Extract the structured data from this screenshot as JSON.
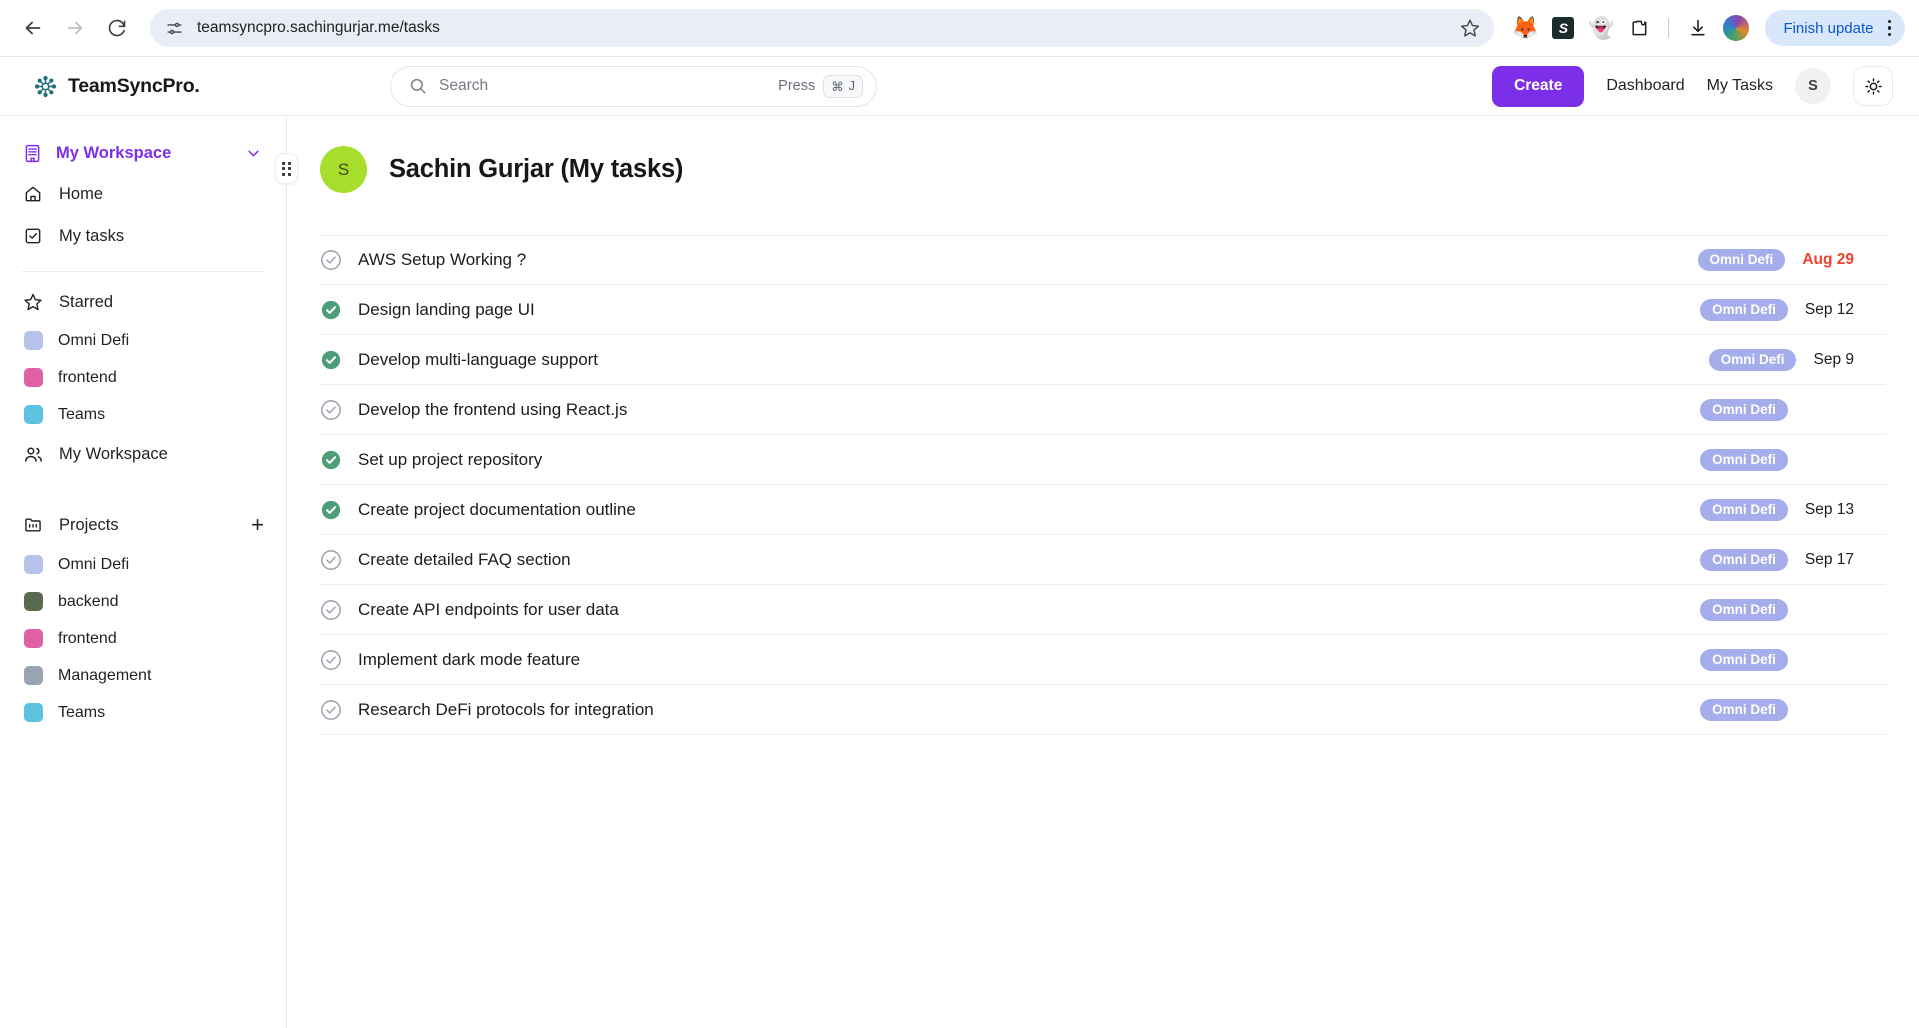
{
  "browser": {
    "back_label": "Back",
    "forward_label": "Forward",
    "reload_label": "Reload",
    "site_info_icon": "tune-icon",
    "url": "teamsyncpro.sachingurjar.me/tasks",
    "bookmark_icon": "star-icon",
    "extensions": [
      {
        "name": "metamask-extension-icon",
        "glyph": "🦊"
      },
      {
        "name": "sublime-extension-icon",
        "glyph": "S"
      },
      {
        "name": "ghost-extension-icon",
        "glyph": "👻"
      },
      {
        "name": "extensions-puzzle-icon",
        "glyph": "⧉"
      }
    ],
    "download_icon": "download-icon",
    "profile_icon": "profile-avatar",
    "update_button": "Finish update",
    "menu_icon": "three-dot-menu-icon"
  },
  "header": {
    "logo_icon": "teamsync-gear-icon",
    "brand": "TeamSyncPro.",
    "search": {
      "icon": "search-icon",
      "placeholder": "Search",
      "value": "",
      "hint_text": "Press",
      "hint_key_cmd": "⌘",
      "hint_key_letter": "J"
    },
    "create_label": "Create",
    "nav": [
      {
        "label": "Dashboard",
        "name": "nav-dashboard"
      },
      {
        "label": "My Tasks",
        "name": "nav-my-tasks"
      }
    ],
    "avatar_initial": "S",
    "theme_toggle_icon": "sun-icon"
  },
  "sidebar": {
    "workspace": {
      "icon": "building-icon",
      "label": "My Workspace",
      "chevron_icon": "chevron-down-icon",
      "accent": "#7c2fe8"
    },
    "nav_items": [
      {
        "label": "Home",
        "icon": "home-icon",
        "name": "sidebar-item-home"
      },
      {
        "label": "My tasks",
        "icon": "check-square-icon",
        "name": "sidebar-item-my-tasks"
      }
    ],
    "starred": {
      "label": "Starred",
      "icon": "star-outline-icon",
      "items": [
        {
          "label": "Omni Defi",
          "color": "#b8c3ec"
        },
        {
          "label": "frontend",
          "color": "#e062a5"
        },
        {
          "label": "Teams",
          "color": "#5cc2e0"
        }
      ],
      "workspace_item": {
        "label": "My Workspace",
        "icon": "users-icon"
      }
    },
    "projects": {
      "label": "Projects",
      "icon": "folder-icon",
      "add_icon": "plus-icon",
      "items": [
        {
          "label": "Omni Defi",
          "color": "#b8c3ec"
        },
        {
          "label": "backend",
          "color": "#5a6a51"
        },
        {
          "label": "frontend",
          "color": "#e062a5"
        },
        {
          "label": "Management",
          "color": "#9aa3b2"
        },
        {
          "label": "Teams",
          "color": "#5cc2e0"
        }
      ]
    },
    "resize_handle_icon": "grip-dots-icon"
  },
  "main": {
    "user": {
      "avatar_initial": "S",
      "avatar_color": "#a6de2b",
      "title": "Sachin Gurjar (My tasks)"
    },
    "tag_color": "#a5adea",
    "overdue_color": "#f0402f",
    "tasks": [
      {
        "title": "AWS Setup Working ?",
        "completed": false,
        "tag": "Omni Defi",
        "due": "Aug 29",
        "overdue": true
      },
      {
        "title": "Design landing page UI",
        "completed": true,
        "tag": "Omni Defi",
        "due": "Sep 12",
        "overdue": false
      },
      {
        "title": "Develop multi-language support",
        "completed": true,
        "tag": "Omni Defi",
        "due": "Sep 9",
        "overdue": false
      },
      {
        "title": "Develop the frontend using React.js",
        "completed": false,
        "tag": "Omni Defi",
        "due": "",
        "overdue": false
      },
      {
        "title": "Set up project repository",
        "completed": true,
        "tag": "Omni Defi",
        "due": "",
        "overdue": false
      },
      {
        "title": "Create project documentation outline",
        "completed": true,
        "tag": "Omni Defi",
        "due": "Sep 13",
        "overdue": false
      },
      {
        "title": "Create detailed FAQ section",
        "completed": false,
        "tag": "Omni Defi",
        "due": "Sep 17",
        "overdue": false
      },
      {
        "title": "Create API endpoints for user data",
        "completed": false,
        "tag": "Omni Defi",
        "due": "",
        "overdue": false
      },
      {
        "title": "Implement dark mode feature",
        "completed": false,
        "tag": "Omni Defi",
        "due": "",
        "overdue": false
      },
      {
        "title": "Research DeFi protocols for integration",
        "completed": false,
        "tag": "Omni Defi",
        "due": "",
        "overdue": false
      }
    ]
  }
}
